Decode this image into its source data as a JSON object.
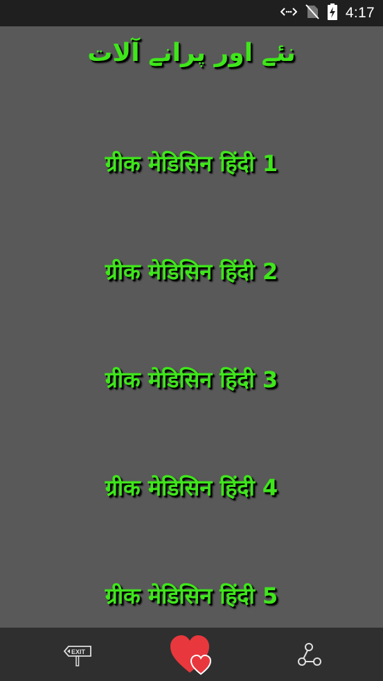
{
  "status_bar": {
    "time": "4:17",
    "icons": [
      "data-sync-icon",
      "no-sim-icon",
      "battery-charging-icon"
    ]
  },
  "title": "نئے اور پرانے آلات",
  "menu_items": [
    {
      "label": "ग्रीक मेडिसिन हिंदी 1"
    },
    {
      "label": "ग्रीक मेडिसिन हिंदी 2"
    },
    {
      "label": "ग्रीक मेडिसिन हिंदी 3"
    },
    {
      "label": "ग्रीक मेडिसिन हिंदी 4"
    },
    {
      "label": "ग्रीक मेडिसिन हिंदी 5"
    }
  ],
  "bottom_bar": {
    "exit_label": "EXIT",
    "icons": [
      "exit-sign-icon",
      "hearts-icon",
      "share-icon"
    ]
  },
  "colors": {
    "status_bar": "#1f1f1f",
    "background": "#595959",
    "text_green": "#3fe61b",
    "bottom_bar": "#2f2f2f",
    "heart_red": "#e8383d"
  }
}
